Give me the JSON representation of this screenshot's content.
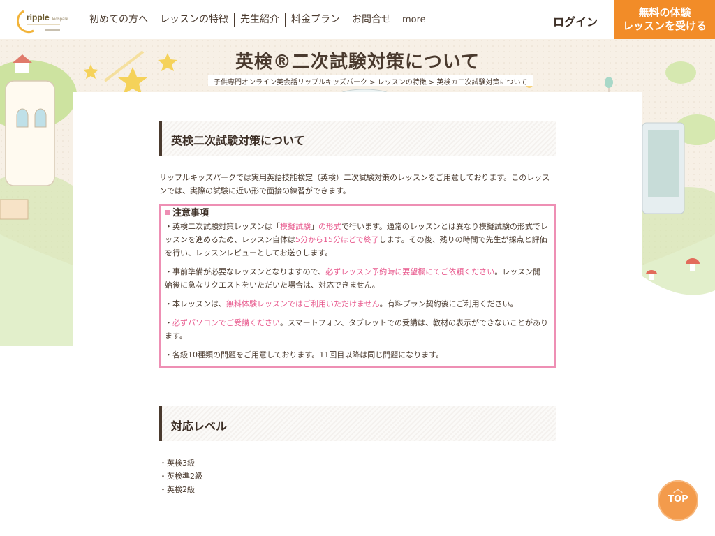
{
  "header": {
    "logo_text": "ripple kidspark",
    "nav": [
      "初めての方へ",
      "レッスンの特徴",
      "先生紹介",
      "料金プラン",
      "お問合せ"
    ],
    "more": "more",
    "login": "ログイン",
    "cta_line1": "無料の体験",
    "cta_line2": "レッスンを受ける"
  },
  "hero": {
    "title": "英検®二次試験対策について",
    "breadcrumb": {
      "home": "子供専門オンライン英会話リップルキッズパーク",
      "sep": " > ",
      "parent": "レッスンの特徴",
      "current": "英検®二次試験対策について"
    }
  },
  "section1": {
    "heading": "英検二次試験対策について",
    "intro": "リップルキッズパークでは実用英語技能検定（英検）二次試験対策のレッスンをご用意しております。このレッスンでは、実際の試験に近い形で面接の練習ができます。"
  },
  "notice": {
    "title": "注意事項",
    "p1": {
      "a": "・英検二次試験対策レッスンは「",
      "b": "模擬試験",
      "c": "」",
      "d": "の形式",
      "e": "で行います。通常のレッスンとは異なり模擬試験の形式でレッスンを進めるため、レッスン自体は",
      "f": "5分から15分ほどで終了",
      "g": "します。その後、残りの時間で先生が採点と評価を行い、レッスンレビューとしてお送りします。"
    },
    "p2": {
      "a": "・事前準備が必要なレッスンとなりますので、",
      "b": "必ずレッスン予約時に要望欄にてご依頼ください",
      "c": "。レッスン開始後に急なリクエストをいただいた場合は、対応できません。"
    },
    "p3": {
      "a": "・本レッスンは、",
      "b": "無料体験レッスンではご利用いただけません",
      "c": "。有料プラン契約後にご利用ください。"
    },
    "p4": {
      "a": "・",
      "b": "必ずパソコンでご受講ください",
      "c": "。スマートフォン、タブレットでの受講は、教材の表示ができないことがあります。"
    },
    "p5": "・各級10種類の問題をご用意しております。11回目以降は同じ問題になります。"
  },
  "section2": {
    "heading": "対応レベル",
    "levels": [
      "・英検3級",
      "・英検準2級",
      "・英検2級"
    ]
  },
  "top_button": {
    "label": "TOP"
  },
  "colors": {
    "accent": "#f28c28",
    "pink": "#e85a8e",
    "border_pink": "#ee8fb4",
    "text": "#4a3a2e"
  }
}
